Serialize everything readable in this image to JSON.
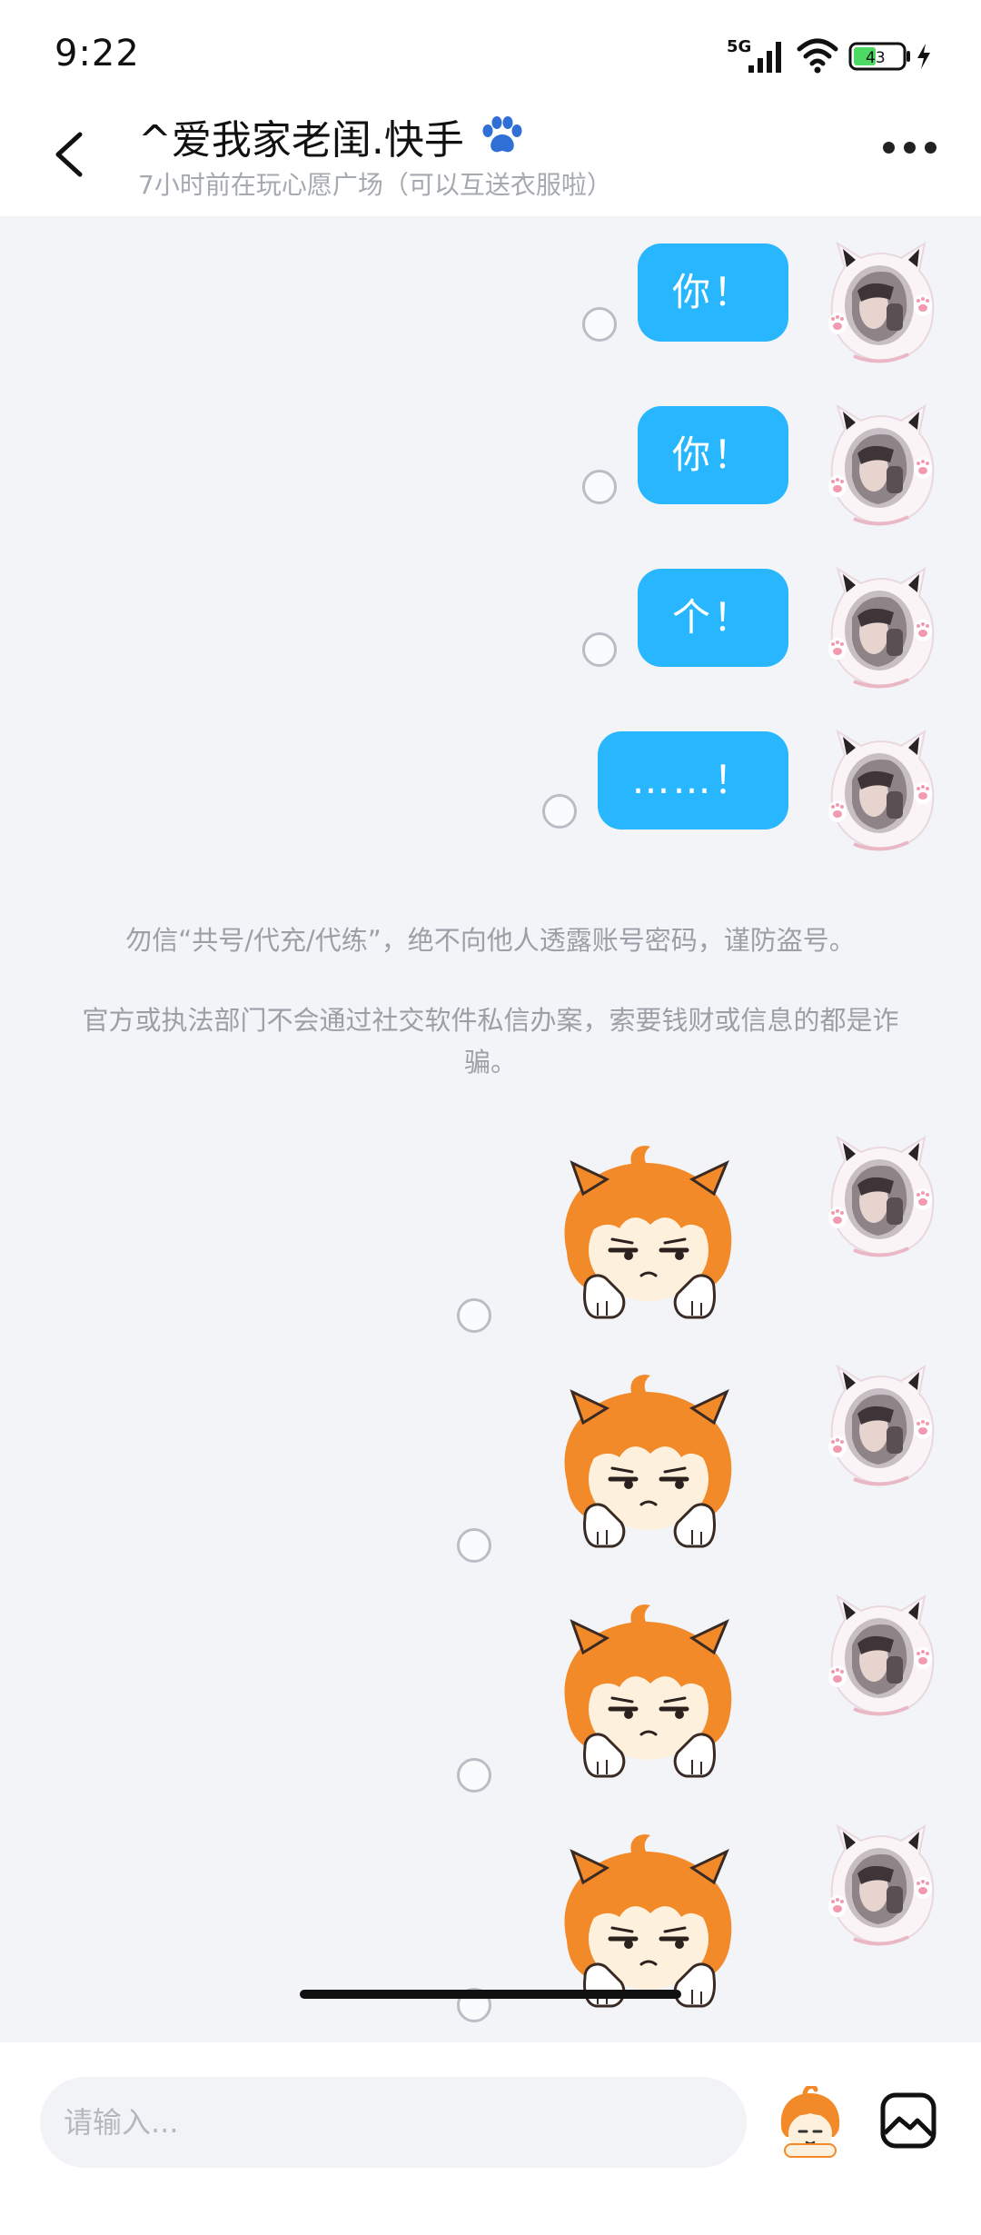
{
  "status_bar": {
    "time": "9:22",
    "network": "5G",
    "battery_level": "43",
    "icons": [
      "signal-icon",
      "wifi-icon",
      "battery-icon",
      "charging-icon"
    ]
  },
  "header": {
    "title": "^爱我家老闺.快手",
    "title_icon": "paw-icon",
    "subtitle": "7小时前在玩心愿广场（可以互送衣服啦）",
    "back_icon": "chevron-left-icon",
    "more_icon": "more-dots-icon"
  },
  "messages": [
    {
      "type": "text",
      "sender": "self",
      "text": "你！"
    },
    {
      "type": "text",
      "sender": "self",
      "text": "你！"
    },
    {
      "type": "text",
      "sender": "self",
      "text": "个！"
    },
    {
      "type": "text",
      "sender": "self",
      "text": "……！"
    }
  ],
  "notice": {
    "line1": "勿信“共号/代充/代练”，绝不向他人透露账号密码，谨防盗号。",
    "line2": "官方或执法部门不会通过社交软件私信办案，索要钱财或信息的都是诈骗。"
  },
  "stickers": [
    {
      "type": "sticker",
      "sender": "self",
      "icon": "orange-hair-character-sticker"
    },
    {
      "type": "sticker",
      "sender": "self",
      "icon": "orange-hair-character-sticker"
    },
    {
      "type": "sticker",
      "sender": "self",
      "icon": "orange-hair-character-sticker"
    },
    {
      "type": "sticker",
      "sender": "self",
      "icon": "orange-hair-character-sticker"
    }
  ],
  "input": {
    "placeholder": "请输入...",
    "value": "",
    "emoji_icon": "emoji-sticker-icon",
    "image_icon": "image-icon"
  },
  "colors": {
    "bubble": "#28b7ff",
    "background": "#f2f4f8",
    "notice_text": "#9ba0a8",
    "sticker_hair": "#f28a2a"
  }
}
